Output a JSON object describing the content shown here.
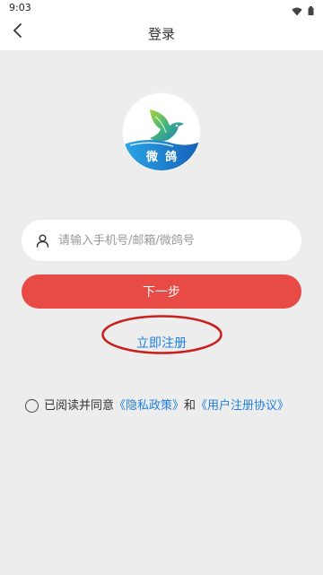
{
  "status_bar": {
    "time": "9:03"
  },
  "header": {
    "title": "登录"
  },
  "logo": {
    "text": "微鸽"
  },
  "account_input": {
    "placeholder": "请输入手机号/邮箱/微鸽号"
  },
  "next_button": {
    "label": "下一步"
  },
  "register_link": {
    "label": "立即注册"
  },
  "agreement": {
    "prefix": "已阅读并同意",
    "privacy_policy": "《隐私政策》",
    "conjunction": "和",
    "user_agreement": "《用户注册协议》"
  },
  "colors": {
    "accent": "#e84b45",
    "link": "#1e7fe0",
    "background": "#ededed",
    "annotation": "#c8201d"
  }
}
